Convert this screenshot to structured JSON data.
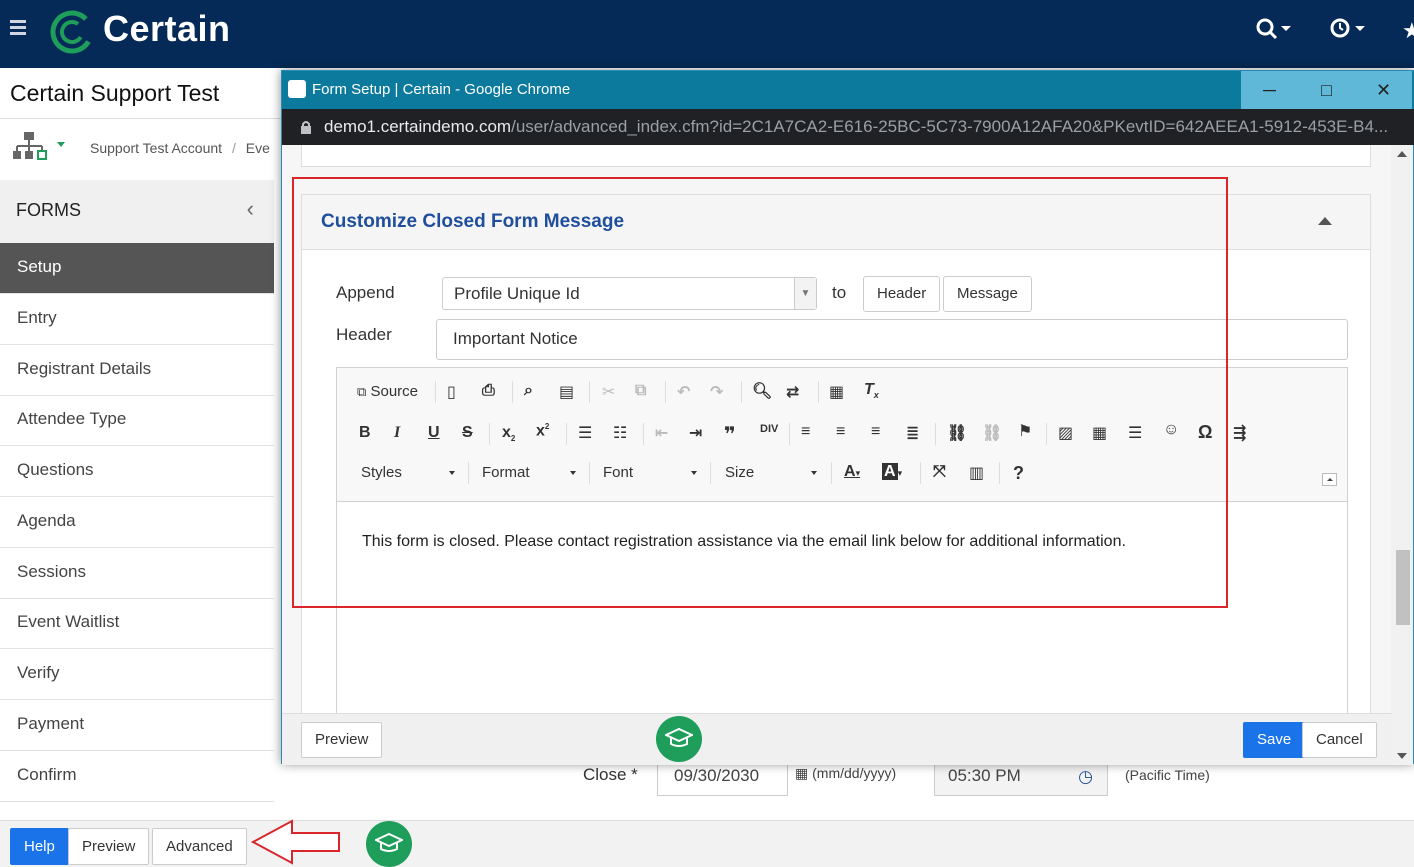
{
  "app": {
    "brand": "Certain",
    "page_title": "Certain Support Test",
    "breadcrumb": [
      "Support Test Account",
      "/",
      "Eve"
    ]
  },
  "sidebar": {
    "heading": "FORMS",
    "items": [
      {
        "label": "Setup",
        "active": true
      },
      {
        "label": "Entry"
      },
      {
        "label": "Registrant Details"
      },
      {
        "label": "Attendee Type"
      },
      {
        "label": "Questions"
      },
      {
        "label": "Agenda"
      },
      {
        "label": "Sessions"
      },
      {
        "label": "Event Waitlist"
      },
      {
        "label": "Verify"
      },
      {
        "label": "Payment"
      },
      {
        "label": "Confirm"
      }
    ]
  },
  "bottom_bar": {
    "help": "Help",
    "preview": "Preview",
    "advanced": "Advanced"
  },
  "background_form": {
    "close_label": "Close *",
    "close_date": "09/30/2030",
    "date_format": "(mm/dd/yyyy)",
    "close_time": "05:30 PM",
    "timezone": "(Pacific Time)"
  },
  "popup": {
    "window_title": "Form Setup | Certain - Google Chrome",
    "url_host": "demo1.certaindemo.com",
    "url_path": "/user/advanced_index.cfm?id=2C1A7CA2-E616-25BC-5C73-7900A12AFA20&PKevtID=642AEEA1-5912-453E-B4...",
    "panel_title": "Customize Closed Form Message",
    "append_label": "Append",
    "append_value": "Profile Unique Id",
    "to_label": "to",
    "header_button": "Header",
    "message_button": "Message",
    "header_label": "Header",
    "header_value": "Important Notice",
    "toolbar": {
      "source": "Source",
      "styles": "Styles",
      "format": "Format",
      "font": "Font",
      "size": "Size"
    },
    "editor_content": "This form is closed. Please contact registration assistance via the email link below for additional information.",
    "footer": {
      "preview": "Preview",
      "save": "Save",
      "cancel": "Cancel"
    }
  },
  "colors": {
    "navbar": "#062a57",
    "brand_green": "#1e9e5a",
    "popup_titlebar": "#0b7a9d",
    "primary_button": "#1a73e8",
    "panel_title": "#1f4e9c",
    "highlight": "#d9262c"
  }
}
